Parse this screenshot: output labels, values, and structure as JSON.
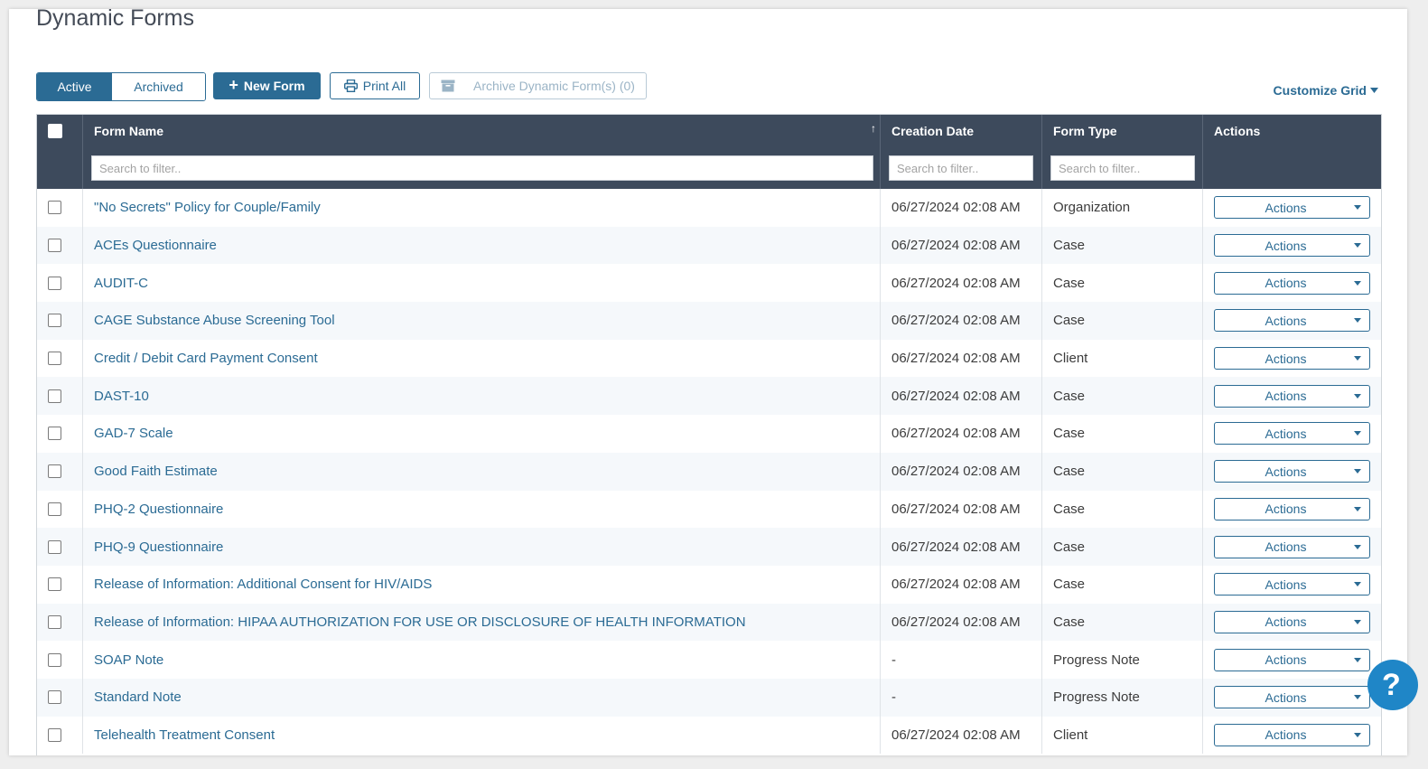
{
  "page": {
    "title": "Dynamic Forms"
  },
  "toolbar": {
    "active_label": "Active",
    "archived_label": "Archived",
    "new_form_label": "New Form",
    "print_all_label": "Print All",
    "archive_label": "Archive Dynamic Form(s) (0)",
    "customize_label": "Customize Grid"
  },
  "grid": {
    "columns": {
      "form_name": "Form Name",
      "creation_date": "Creation Date",
      "form_type": "Form Type",
      "actions": "Actions"
    },
    "filter_placeholder": "Search to filter..",
    "action_label": "Actions",
    "rows": [
      {
        "name": "\"No Secrets\" Policy for Couple/Family",
        "date": "06/27/2024 02:08 AM",
        "type": "Organization"
      },
      {
        "name": "ACEs Questionnaire",
        "date": "06/27/2024 02:08 AM",
        "type": "Case"
      },
      {
        "name": "AUDIT-C",
        "date": "06/27/2024 02:08 AM",
        "type": "Case"
      },
      {
        "name": "CAGE Substance Abuse Screening Tool",
        "date": "06/27/2024 02:08 AM",
        "type": "Case"
      },
      {
        "name": "Credit / Debit Card Payment Consent",
        "date": "06/27/2024 02:08 AM",
        "type": "Client"
      },
      {
        "name": "DAST-10",
        "date": "06/27/2024 02:08 AM",
        "type": "Case"
      },
      {
        "name": "GAD-7 Scale",
        "date": "06/27/2024 02:08 AM",
        "type": "Case"
      },
      {
        "name": "Good Faith Estimate",
        "date": "06/27/2024 02:08 AM",
        "type": "Case"
      },
      {
        "name": "PHQ-2 Questionnaire",
        "date": "06/27/2024 02:08 AM",
        "type": "Case"
      },
      {
        "name": "PHQ-9 Questionnaire",
        "date": "06/27/2024 02:08 AM",
        "type": "Case"
      },
      {
        "name": "Release of Information: Additional Consent for HIV/AIDS",
        "date": "06/27/2024 02:08 AM",
        "type": "Case"
      },
      {
        "name": "Release of Information: HIPAA AUTHORIZATION FOR USE OR DISCLOSURE OF HEALTH INFORMATION",
        "date": "06/27/2024 02:08 AM",
        "type": "Case"
      },
      {
        "name": "SOAP Note",
        "date": "-",
        "type": "Progress Note"
      },
      {
        "name": "Standard Note",
        "date": "-",
        "type": "Progress Note"
      },
      {
        "name": "Telehealth Treatment Consent",
        "date": "06/27/2024 02:08 AM",
        "type": "Client"
      }
    ]
  },
  "help": {
    "label": "?"
  },
  "colors": {
    "primary": "#2b6b94",
    "header_bg": "#3d4a5c",
    "help_bg": "#1f86c7"
  },
  "icons": {
    "new_form": "plus-icon",
    "print": "printer-icon",
    "archive": "archive-box-icon",
    "sort": "sort-asc-icon",
    "dropdown": "caret-down-icon"
  }
}
